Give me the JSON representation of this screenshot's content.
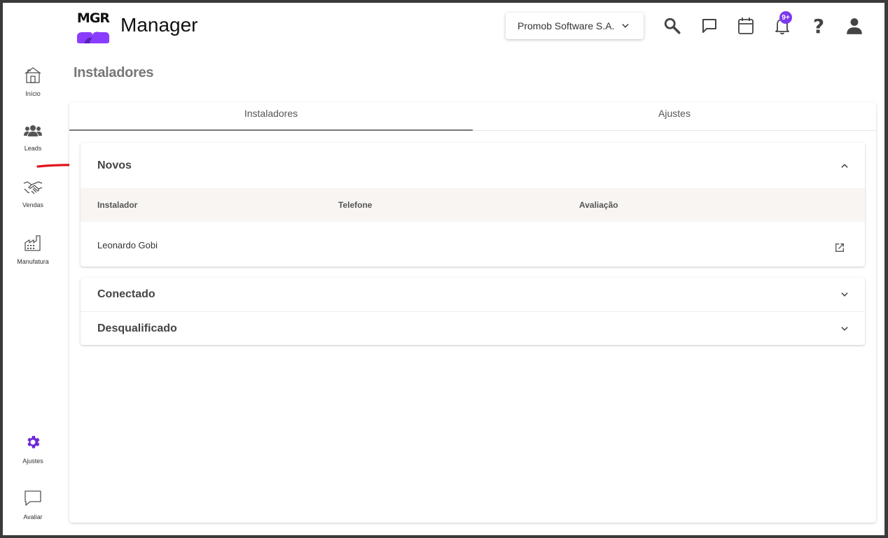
{
  "header": {
    "logo_text": "MGR",
    "app_title": "Manager",
    "company": "Promob Software S.A.",
    "notification_badge": "9+",
    "icons": [
      "search-icon",
      "chat-icon",
      "calendar-icon",
      "bell-icon",
      "help-icon",
      "user-icon"
    ]
  },
  "sidebar": {
    "items": [
      {
        "label": "Início",
        "icon": "home-icon"
      },
      {
        "label": "Leads",
        "icon": "group-icon"
      },
      {
        "label": "Vendas",
        "icon": "handshake-icon"
      },
      {
        "label": "Manufatura",
        "icon": "factory-icon"
      }
    ],
    "bottom_items": [
      {
        "label": "Ajustes",
        "icon": "gear-icon",
        "active": true
      },
      {
        "label": "Avaliar",
        "icon": "comment-icon"
      }
    ]
  },
  "page": {
    "title": "Instaladores",
    "tabs": [
      {
        "label": "Instaladores",
        "active": true
      },
      {
        "label": "Ajustes",
        "active": false
      }
    ]
  },
  "sections": {
    "novos": {
      "title": "Novos",
      "expanded": true,
      "columns": [
        "Instalador",
        "Telefone",
        "Avaliação"
      ],
      "rows": [
        {
          "instalador": "Leonardo Gobi",
          "telefone": "",
          "avaliacao": ""
        }
      ]
    },
    "conectado": {
      "title": "Conectado",
      "expanded": false
    },
    "desqualificado": {
      "title": "Desqualificado",
      "expanded": false
    }
  },
  "colors": {
    "accent": "#6d28d9",
    "table_header_bg": "#f8f5f2",
    "annotation_arrow": "#e0141e"
  }
}
